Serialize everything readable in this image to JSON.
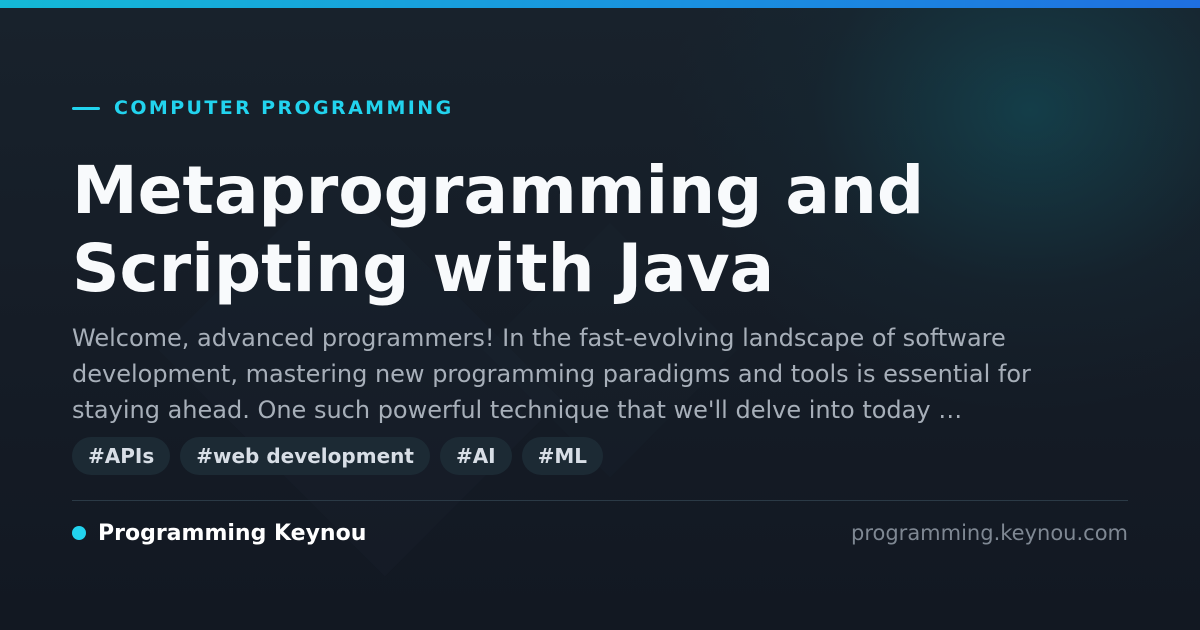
{
  "category": {
    "label": "COMPUTER PROGRAMMING"
  },
  "title": "Metaprogramming and Scripting with Java",
  "description": "Welcome, advanced programmers! In the fast-evolving landscape of software development, mastering new programming paradigms and tools is essential for staying ahead. One such powerful technique that we'll delve into today …",
  "tags": [
    "#APIs",
    "#web development",
    "#AI",
    "#ML"
  ],
  "footer": {
    "brand_name": "Programming Keynou",
    "domain": "programming.keynou.com"
  },
  "colors": {
    "accent": "#22d3ee",
    "background": "#131a23",
    "title": "#f8fafc",
    "muted": "#a7afb9",
    "tag_background": "#1c2a34"
  }
}
